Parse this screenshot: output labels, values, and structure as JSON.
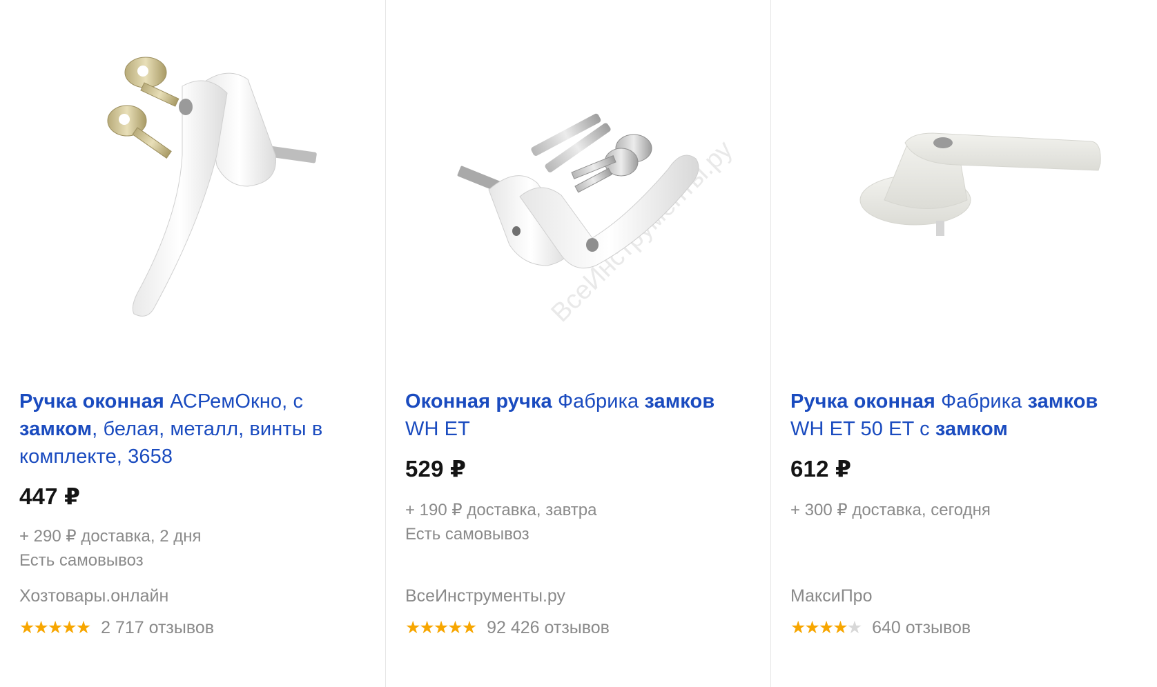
{
  "products": [
    {
      "title_parts": [
        {
          "text": "Ручка оконная",
          "bold": true
        },
        {
          "text": " АСРемОкно, с ",
          "bold": false
        },
        {
          "text": "замком",
          "bold": true
        },
        {
          "text": ", белая, металл, винты в комплекте, 3658",
          "bold": false
        }
      ],
      "price": "447 ₽",
      "delivery": "+ 290 ₽ доставка, 2 дня",
      "pickup": "Есть самовывоз",
      "shop": "Хозтовары.онлайн",
      "rating_stars": 5,
      "reviews": "2 717 отзывов",
      "image_icon": "window-handle-with-keys-icon"
    },
    {
      "title_parts": [
        {
          "text": "Оконная ручка",
          "bold": true
        },
        {
          "text": " Фабрика ",
          "bold": false
        },
        {
          "text": "замков",
          "bold": true
        },
        {
          "text": " WH ET",
          "bold": false
        }
      ],
      "price": "529 ₽",
      "delivery": "+ 190 ₽ доставка, завтра",
      "pickup": "Есть самовывоз",
      "shop": "ВсеИнструменты.ру",
      "rating_stars": 5,
      "reviews": "92 426 отзывов",
      "image_icon": "window-handle-with-screws-icon",
      "watermark": "ВсеИнструменты.ру"
    },
    {
      "title_parts": [
        {
          "text": "Ручка оконная",
          "bold": true
        },
        {
          "text": " Фабрика ",
          "bold": false
        },
        {
          "text": "замков",
          "bold": true
        },
        {
          "text": " WH ET 50 ET с ",
          "bold": false
        },
        {
          "text": "замком",
          "bold": true
        }
      ],
      "price": "612 ₽",
      "delivery": "+ 300 ₽ доставка, сегодня",
      "pickup": "",
      "shop": "МаксиПро",
      "rating_stars": 4,
      "reviews": "640 отзывов",
      "image_icon": "window-handle-lock-icon"
    }
  ],
  "colors": {
    "link": "#1a4bbf",
    "price": "#141414",
    "muted": "#8a8a8a",
    "star": "#f7a600",
    "star_off": "#d8d8d8"
  }
}
